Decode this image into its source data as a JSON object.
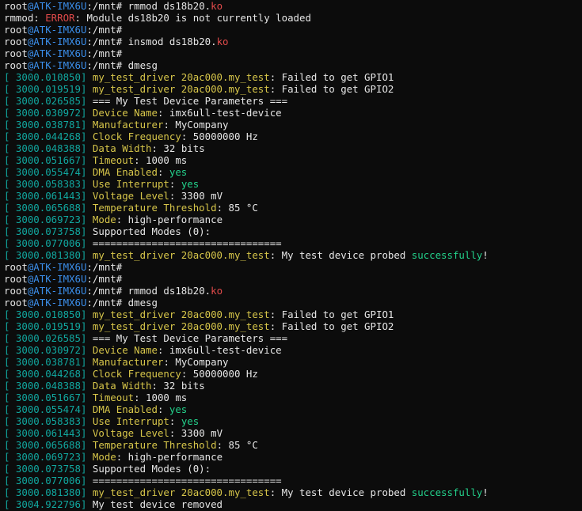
{
  "colors": {
    "background": "#0c0c0c",
    "text": "#e6e6e6",
    "host": "#3b8eea",
    "error": "#e24b4b",
    "timestamp": "#11a8a0",
    "key": "#d7c64a",
    "success": "#23d18b"
  },
  "lines": [
    [
      [
        "white",
        "root"
      ],
      [
        "blue",
        "@ATK-IMX6U"
      ],
      [
        "white",
        ":/mnt# rmmod ds18b20."
      ],
      [
        "red",
        "ko"
      ]
    ],
    [
      [
        "white",
        "rmmod: "
      ],
      [
        "red",
        "ERROR"
      ],
      [
        "white",
        ": Module ds18b20 is not currently loaded"
      ]
    ],
    [
      [
        "white",
        "root"
      ],
      [
        "blue",
        "@ATK-IMX6U"
      ],
      [
        "white",
        ":/mnt#"
      ]
    ],
    [
      [
        "white",
        "root"
      ],
      [
        "blue",
        "@ATK-IMX6U"
      ],
      [
        "white",
        ":/mnt# insmod ds18b20."
      ],
      [
        "red",
        "ko"
      ]
    ],
    [
      [
        "white",
        "root"
      ],
      [
        "blue",
        "@ATK-IMX6U"
      ],
      [
        "white",
        ":/mnt#"
      ]
    ],
    [
      [
        "white",
        "root"
      ],
      [
        "blue",
        "@ATK-IMX6U"
      ],
      [
        "white",
        ":/mnt# dmesg"
      ]
    ],
    [
      [
        "ts",
        "[ 3000.010850] "
      ],
      [
        "yellow",
        "my_test_driver 20ac000.my_test"
      ],
      [
        "white",
        ": Failed to get GPIO1"
      ]
    ],
    [
      [
        "ts",
        "[ 3000.019519] "
      ],
      [
        "yellow",
        "my_test_driver 20ac000.my_test"
      ],
      [
        "white",
        ": Failed to get GPIO2"
      ]
    ],
    [
      [
        "ts",
        "[ 3000.026585] "
      ],
      [
        "white",
        "=== My Test Device Parameters ==="
      ]
    ],
    [
      [
        "ts",
        "[ 3000.030972] "
      ],
      [
        "yellow",
        "Device Name"
      ],
      [
        "white",
        ": imx6ull-test-device"
      ]
    ],
    [
      [
        "ts",
        "[ 3000.038781] "
      ],
      [
        "yellow",
        "Manufacturer"
      ],
      [
        "white",
        ": MyCompany"
      ]
    ],
    [
      [
        "ts",
        "[ 3000.044268] "
      ],
      [
        "yellow",
        "Clock Frequency"
      ],
      [
        "white",
        ": 50000000 Hz"
      ]
    ],
    [
      [
        "ts",
        "[ 3000.048388] "
      ],
      [
        "yellow",
        "Data Width"
      ],
      [
        "white",
        ": 32 bits"
      ]
    ],
    [
      [
        "ts",
        "[ 3000.051667] "
      ],
      [
        "yellow",
        "Timeout"
      ],
      [
        "white",
        ": 1000 ms"
      ]
    ],
    [
      [
        "ts",
        "[ 3000.055474] "
      ],
      [
        "yellow",
        "DMA Enabled"
      ],
      [
        "white",
        ": "
      ],
      [
        "green",
        "yes"
      ]
    ],
    [
      [
        "ts",
        "[ 3000.058383] "
      ],
      [
        "yellow",
        "Use Interrupt"
      ],
      [
        "white",
        ": "
      ],
      [
        "green",
        "yes"
      ]
    ],
    [
      [
        "ts",
        "[ 3000.061443] "
      ],
      [
        "yellow",
        "Voltage Level"
      ],
      [
        "white",
        ": 3300 mV"
      ]
    ],
    [
      [
        "ts",
        "[ 3000.065688] "
      ],
      [
        "yellow",
        "Temperature Threshold"
      ],
      [
        "white",
        ": 85 °C"
      ]
    ],
    [
      [
        "ts",
        "[ 3000.069723] "
      ],
      [
        "yellow",
        "Mode"
      ],
      [
        "white",
        ": high-performance"
      ]
    ],
    [
      [
        "ts",
        "[ 3000.073758] "
      ],
      [
        "white",
        "Supported Modes (0):"
      ]
    ],
    [
      [
        "ts",
        "[ 3000.077006] "
      ],
      [
        "white",
        "================================"
      ]
    ],
    [
      [
        "ts",
        "[ 3000.081380] "
      ],
      [
        "yellow",
        "my_test_driver 20ac000.my_test"
      ],
      [
        "white",
        ": My test device probed "
      ],
      [
        "green",
        "successfully"
      ],
      [
        "white",
        "!"
      ]
    ],
    [
      [
        "white",
        "root"
      ],
      [
        "blue",
        "@ATK-IMX6U"
      ],
      [
        "white",
        ":/mnt#"
      ]
    ],
    [
      [
        "white",
        "root"
      ],
      [
        "blue",
        "@ATK-IMX6U"
      ],
      [
        "white",
        ":/mnt#"
      ]
    ],
    [
      [
        "white",
        "root"
      ],
      [
        "blue",
        "@ATK-IMX6U"
      ],
      [
        "white",
        ":/mnt# rmmod ds18b20."
      ],
      [
        "red",
        "ko"
      ]
    ],
    [
      [
        "white",
        "root"
      ],
      [
        "blue",
        "@ATK-IMX6U"
      ],
      [
        "white",
        ":/mnt# dmesg"
      ]
    ],
    [
      [
        "ts",
        "[ 3000.010850] "
      ],
      [
        "yellow",
        "my_test_driver 20ac000.my_test"
      ],
      [
        "white",
        ": Failed to get GPIO1"
      ]
    ],
    [
      [
        "ts",
        "[ 3000.019519] "
      ],
      [
        "yellow",
        "my_test_driver 20ac000.my_test"
      ],
      [
        "white",
        ": Failed to get GPIO2"
      ]
    ],
    [
      [
        "ts",
        "[ 3000.026585] "
      ],
      [
        "white",
        "=== My Test Device Parameters ==="
      ]
    ],
    [
      [
        "ts",
        "[ 3000.030972] "
      ],
      [
        "yellow",
        "Device Name"
      ],
      [
        "white",
        ": imx6ull-test-device"
      ]
    ],
    [
      [
        "ts",
        "[ 3000.038781] "
      ],
      [
        "yellow",
        "Manufacturer"
      ],
      [
        "white",
        ": MyCompany"
      ]
    ],
    [
      [
        "ts",
        "[ 3000.044268] "
      ],
      [
        "yellow",
        "Clock Frequency"
      ],
      [
        "white",
        ": 50000000 Hz"
      ]
    ],
    [
      [
        "ts",
        "[ 3000.048388] "
      ],
      [
        "yellow",
        "Data Width"
      ],
      [
        "white",
        ": 32 bits"
      ]
    ],
    [
      [
        "ts",
        "[ 3000.051667] "
      ],
      [
        "yellow",
        "Timeout"
      ],
      [
        "white",
        ": 1000 ms"
      ]
    ],
    [
      [
        "ts",
        "[ 3000.055474] "
      ],
      [
        "yellow",
        "DMA Enabled"
      ],
      [
        "white",
        ": "
      ],
      [
        "green",
        "yes"
      ]
    ],
    [
      [
        "ts",
        "[ 3000.058383] "
      ],
      [
        "yellow",
        "Use Interrupt"
      ],
      [
        "white",
        ": "
      ],
      [
        "green",
        "yes"
      ]
    ],
    [
      [
        "ts",
        "[ 3000.061443] "
      ],
      [
        "yellow",
        "Voltage Level"
      ],
      [
        "white",
        ": 3300 mV"
      ]
    ],
    [
      [
        "ts",
        "[ 3000.065688] "
      ],
      [
        "yellow",
        "Temperature Threshold"
      ],
      [
        "white",
        ": 85 °C"
      ]
    ],
    [
      [
        "ts",
        "[ 3000.069723] "
      ],
      [
        "yellow",
        "Mode"
      ],
      [
        "white",
        ": high-performance"
      ]
    ],
    [
      [
        "ts",
        "[ 3000.073758] "
      ],
      [
        "white",
        "Supported Modes (0):"
      ]
    ],
    [
      [
        "ts",
        "[ 3000.077006] "
      ],
      [
        "white",
        "================================"
      ]
    ],
    [
      [
        "ts",
        "[ 3000.081380] "
      ],
      [
        "yellow",
        "my_test_driver 20ac000.my_test"
      ],
      [
        "white",
        ": My test device probed "
      ],
      [
        "green",
        "successfully"
      ],
      [
        "white",
        "!"
      ]
    ],
    [
      [
        "ts",
        "[ 3004.922796] "
      ],
      [
        "white",
        "My test device removed"
      ]
    ]
  ]
}
